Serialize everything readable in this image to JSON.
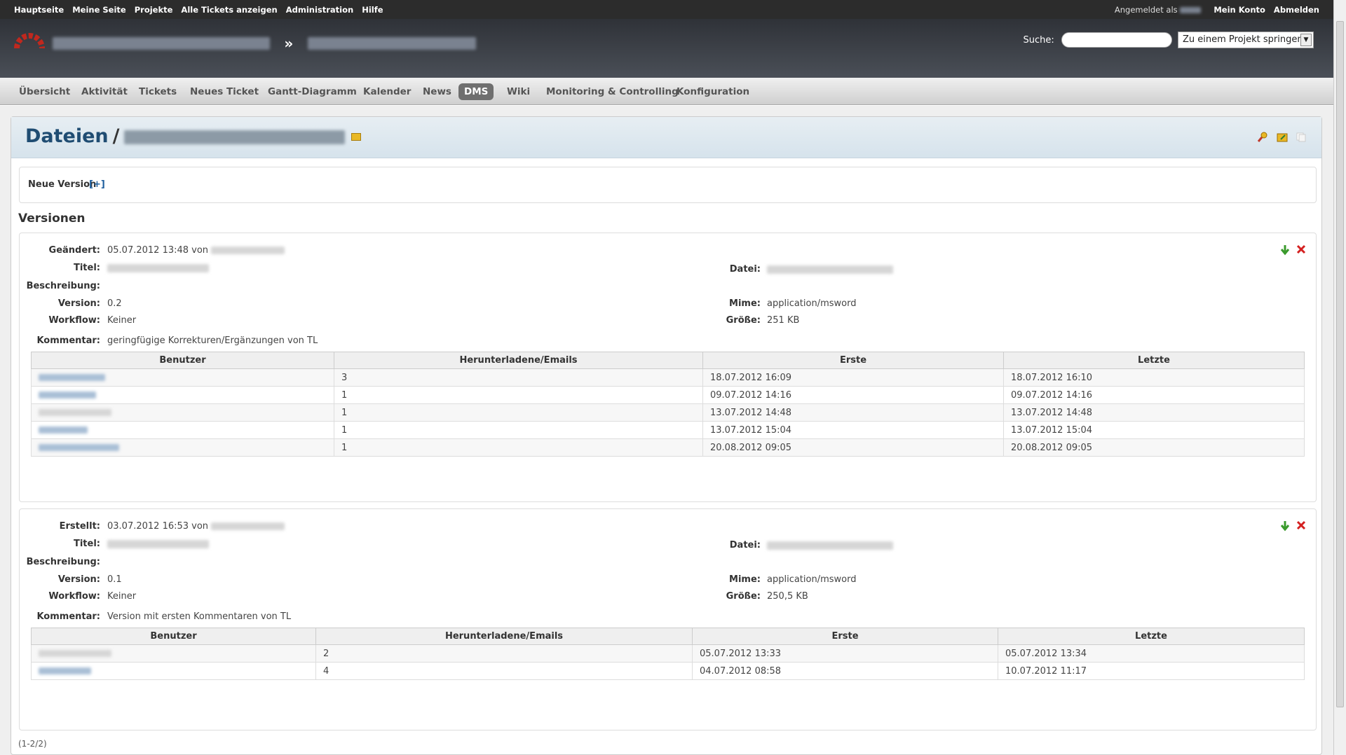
{
  "top_menu": {
    "items": [
      "Hauptseite",
      "Meine Seite",
      "Projekte",
      "Alle Tickets anzeigen",
      "Administration",
      "Hilfe"
    ],
    "logged_as": "Angemeldet als",
    "account": "Mein Konto",
    "logout": "Abmelden"
  },
  "header": {
    "separator": "»",
    "search_label": "Suche:",
    "jump_label": "Zu einem Projekt springen..."
  },
  "main_menu": {
    "tabs": [
      "Übersicht",
      "Aktivität",
      "Tickets",
      "Neues Ticket",
      "Gantt-Diagramm",
      "Kalender",
      "News",
      "DMS",
      "Wiki",
      "Monitoring & Controlling",
      "Konfiguration"
    ],
    "selected": "DMS"
  },
  "page": {
    "title": "Dateien",
    "slash": "/",
    "new_version": "Neue Version",
    "new_version_toggle": "[+]",
    "versions_heading": "Versionen",
    "pagination": "(1-2/2)"
  },
  "versions": [
    {
      "changed_label": "Geändert:",
      "changed_value": "05.07.2012 13:48 von",
      "title_label": "Titel:",
      "file_label": "Datei:",
      "description_label": "Beschreibung:",
      "version_label": "Version:",
      "version_value": "0.2",
      "mime_label": "Mime:",
      "mime_value": "application/msword",
      "workflow_label": "Workflow:",
      "workflow_value": "Keiner",
      "size_label": "Größe:",
      "size_value": "251 KB",
      "comment_label": "Kommentar:",
      "comment_value": "geringfügige Korrekturen/Ergänzungen von TL",
      "table": {
        "headers": [
          "Benutzer",
          "Herunterladene/Emails",
          "Erste",
          "Letzte"
        ],
        "rows": [
          {
            "count": "3",
            "first": "18.07.2012 16:09",
            "last": "18.07.2012 16:10"
          },
          {
            "count": "1",
            "first": "09.07.2012 14:16",
            "last": "09.07.2012 14:16"
          },
          {
            "count": "1",
            "first": "13.07.2012 14:48",
            "last": "13.07.2012 14:48"
          },
          {
            "count": "1",
            "first": "13.07.2012 15:04",
            "last": "13.07.2012 15:04"
          },
          {
            "count": "1",
            "first": "20.08.2012 09:05",
            "last": "20.08.2012 09:05"
          }
        ]
      }
    },
    {
      "changed_label": "Erstellt:",
      "changed_value": "03.07.2012 16:53 von",
      "title_label": "Titel:",
      "file_label": "Datei:",
      "description_label": "Beschreibung:",
      "version_label": "Version:",
      "version_value": "0.1",
      "mime_label": "Mime:",
      "mime_value": "application/msword",
      "workflow_label": "Workflow:",
      "workflow_value": "Keiner",
      "size_label": "Größe:",
      "size_value": "250,5 KB",
      "comment_label": "Kommentar:",
      "comment_value": "Version mit ersten Kommentaren von TL",
      "table": {
        "headers": [
          "Benutzer",
          "Herunterladene/Emails",
          "Erste",
          "Letzte"
        ],
        "rows": [
          {
            "count": "2",
            "first": "05.07.2012 13:33",
            "last": "05.07.2012 13:34"
          },
          {
            "count": "4",
            "first": "04.07.2012 08:58",
            "last": "10.07.2012 11:17"
          }
        ]
      }
    }
  ]
}
